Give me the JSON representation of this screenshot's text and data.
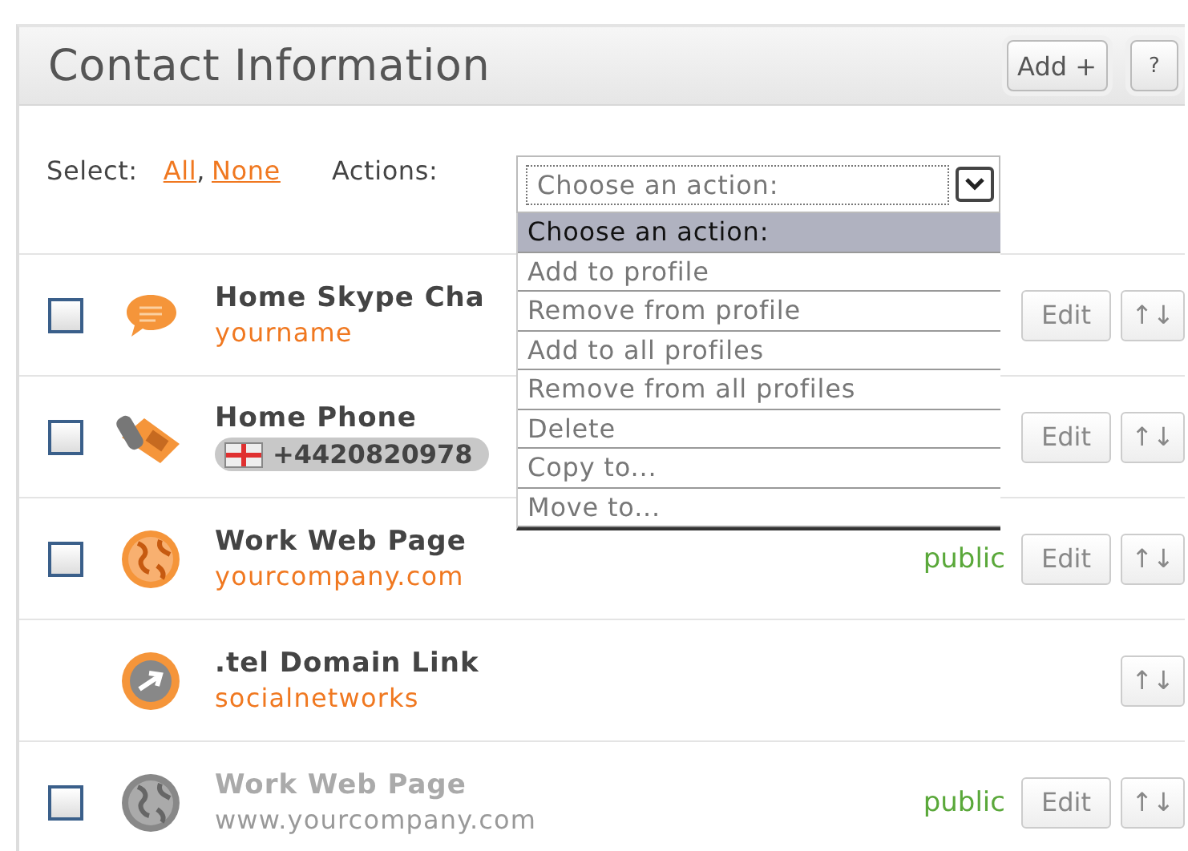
{
  "panel": {
    "title": "Contact Information",
    "buttons": [
      {
        "label": "Add +"
      },
      {
        "label": "?"
      }
    ]
  },
  "select": {
    "label": "Select:",
    "links": [
      "All",
      "None"
    ],
    "separator": ","
  },
  "actions": {
    "label": "Actions:",
    "value": "Choose an action:",
    "options": [
      {
        "label": "Choose an action:",
        "selected": true
      },
      {
        "label": "Add to profile",
        "selected": false
      },
      {
        "label": "Remove from profile",
        "selected": false
      },
      {
        "label": "Add to all profiles",
        "selected": false
      },
      {
        "label": "Remove from all profiles",
        "selected": false
      },
      {
        "label": "Delete",
        "selected": false
      },
      {
        "label": "Copy to...",
        "selected": false
      },
      {
        "label": "Move to...",
        "selected": false
      }
    ]
  },
  "rows": [
    {
      "kind": "chat",
      "title": "Home Skype Cha",
      "value": "yourname",
      "checked": false,
      "disabled": false,
      "edit": "Edit",
      "move": "↑↓"
    },
    {
      "kind": "phone",
      "title": "Home Phone",
      "value": "+4420820978",
      "checked": false,
      "disabled": false,
      "edit": "Edit",
      "move": "↑↓"
    },
    {
      "kind": "globe",
      "title": "Work Web Page",
      "value": "yourcompany.com",
      "checked": false,
      "disabled": false,
      "visibility": "public",
      "edit": "Edit",
      "move": "↑↓"
    },
    {
      "kind": "link",
      "title": ".tel Domain Link",
      "value": "socialnetworks",
      "disabled": false,
      "move": "↑↓"
    },
    {
      "kind": "globe",
      "title": "Work Web Page",
      "value": "www.yourcompany.com",
      "checked": false,
      "disabled": true,
      "visibility": "public",
      "edit": "Edit",
      "move": "↑↓"
    }
  ]
}
